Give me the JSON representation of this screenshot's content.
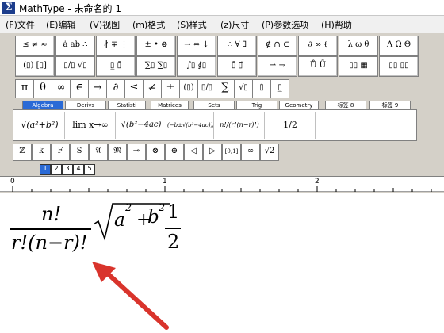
{
  "window": {
    "title": "MathType - 未命名的 1",
    "app_icon_glyph": "Σ"
  },
  "menu": [
    "(F)文件",
    "(E)编辑",
    "(V)视图",
    "(m)格式",
    "(S)样式",
    "(z)尺寸",
    "(P)参数选项",
    "(H)帮助"
  ],
  "palettes_row1": [
    "≤ ≠ ≈",
    "ȧ ab ∴",
    "∦ ∓ ⋮",
    "± • ⊗",
    "→ ⇔ ↓",
    "∴ ∀ ∃",
    "∉ ∩ ⊂",
    "∂ ∞ ℓ",
    "λ ω θ",
    "Λ Ω Θ"
  ],
  "palettes_row2": [
    "(▯) [▯]",
    "▯/▯ √▯",
    "▯̲ ▯̄",
    "∑▯ ∑▯",
    "∫▯ ∮▯",
    "▯̄ ▯⃗",
    "⇀ ⇁",
    "Ů Ũ",
    "▯▯ ▦",
    "▯▯ ▯▯"
  ],
  "symbols_row": [
    "π",
    "θ",
    "∞",
    "∈",
    "→",
    "∂",
    "≤",
    "≠",
    "±",
    "(▯)",
    "▯/▯",
    "∑",
    "√▯",
    "▯̇",
    "▯̲"
  ],
  "tabs": [
    "Algebra",
    "Derivs",
    "Statisti",
    "Matrices",
    "Sets",
    "Trig",
    "Geometry",
    "标签 8",
    "标签 9"
  ],
  "templates": [
    "√(a²+b²)",
    "lim x→∞",
    "√(b²−4ac)",
    "(−b±√(b²−4ac))/2a",
    "n!/(r!(n−r)!)",
    "1/2"
  ],
  "symbols_row2": [
    "ℤ",
    "k",
    "F",
    "S",
    "𝔄",
    "𝔐",
    "⊸",
    "⊗",
    "⊕",
    "◁",
    "▷",
    "[0,1]",
    "∞",
    "√2"
  ],
  "size_buttons": [
    "1",
    "2",
    "3",
    "4",
    "5"
  ],
  "ruler_labels": [
    "0",
    "1",
    "2"
  ],
  "equation": {
    "frac1_num": "n!",
    "frac1_den": "r!(n−r)!",
    "sqrt_body_a": "a",
    "sqrt_body_plus": "+",
    "sqrt_body_b": "b",
    "exp": "2",
    "frac2_num": "1",
    "frac2_den": "2"
  },
  "colors": {
    "arrow": "#d9342c",
    "tab_active": "#2a6ad6",
    "toolbar_bg": "#d4d0c8"
  }
}
